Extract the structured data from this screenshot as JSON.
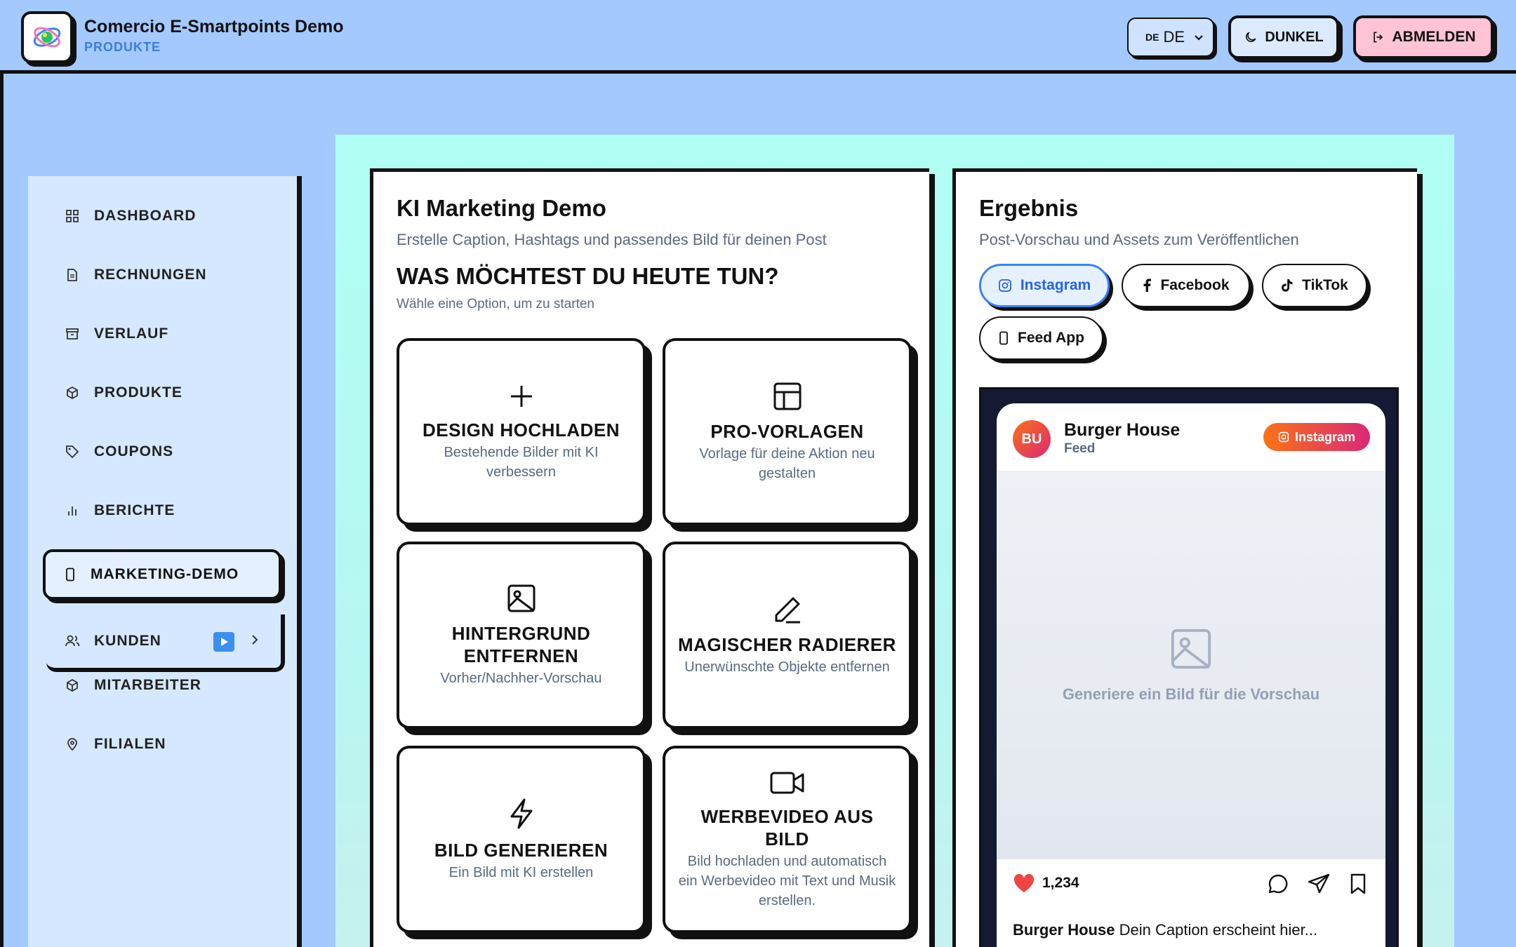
{
  "header": {
    "app_title": "Comercio E-Smartpoints Demo",
    "app_subtitle": "PRODUKTE",
    "lang_code": "DE",
    "lang_label": "DE",
    "dark_label": "DUNKEL",
    "logout_label": "ABMELDEN"
  },
  "sidebar": {
    "items": [
      {
        "label": "DASHBOARD",
        "icon": "grid-icon"
      },
      {
        "label": "RECHNUNGEN",
        "icon": "document-icon"
      },
      {
        "label": "VERLAUF",
        "icon": "archive-icon"
      },
      {
        "label": "PRODUKTE",
        "icon": "box-icon"
      },
      {
        "label": "COUPONS",
        "icon": "tag-icon"
      },
      {
        "label": "BERICHTE",
        "icon": "bar-chart-icon"
      },
      {
        "label": "MARKETING-DEMO",
        "icon": "phone-icon"
      },
      {
        "label": "KUNDEN",
        "icon": "users-icon"
      },
      {
        "label": "MITARBEITER",
        "icon": "box-icon"
      },
      {
        "label": "FILIALEN",
        "icon": "map-pin-icon"
      }
    ],
    "active": "MARKETING-DEMO"
  },
  "demo": {
    "title": "KI Marketing Demo",
    "subtitle": "Erstelle Caption, Hashtags und passendes Bild für deinen Post",
    "question": "WAS MÖCHTEST DU HEUTE TUN?",
    "hint": "Wähle eine Option, um zu starten",
    "tiles": [
      {
        "title": "DESIGN HOCHLADEN",
        "desc": "Bestehende Bilder mit KI verbessern",
        "icon": "plus-icon"
      },
      {
        "title": "PRO-VORLAGEN",
        "desc": "Vorlage für deine Aktion neu gestalten",
        "icon": "layout-icon"
      },
      {
        "title": "HINTERGRUND ENTFERNEN",
        "desc": "Vorher/Nachher-Vorschau",
        "icon": "image-icon"
      },
      {
        "title": "MAGISCHER RADIERER",
        "desc": "Unerwünschte Objekte entfernen",
        "icon": "pen-icon"
      },
      {
        "title": "BILD GENERIEREN",
        "desc": "Ein Bild mit KI erstellen",
        "icon": "lightning-icon"
      },
      {
        "title": "WERBEVIDEO AUS BILD",
        "desc": "Bild hochladen und automatisch ein Werbevideo mit Text und Musik erstellen.",
        "icon": "video-icon"
      }
    ]
  },
  "result": {
    "title": "Ergebnis",
    "subtitle": "Post-Vorschau und Assets zum Veröffentlichen",
    "tabs": [
      {
        "label": "Instagram",
        "icon": "instagram-icon",
        "active": true
      },
      {
        "label": "Facebook",
        "icon": "facebook-icon",
        "active": false
      },
      {
        "label": "TikTok",
        "icon": "tiktok-icon",
        "active": false
      },
      {
        "label": "Feed App",
        "icon": "phone-icon",
        "active": false
      }
    ],
    "post": {
      "avatar_initials": "BU",
      "account_name": "Burger House",
      "account_sub": "Feed",
      "platform_badge": "Instagram",
      "placeholder_text": "Generiere ein Bild für die Vorschau",
      "likes": "1,234",
      "caption_name": "Burger House",
      "caption_text": "Dein Caption erscheint hier..."
    }
  },
  "colors": {
    "page_bg": "#a3c9ff",
    "main_bg": "#b0fff4",
    "accent": "#3b82f6",
    "logout": "#ffc4d6",
    "ink": "#111111"
  }
}
